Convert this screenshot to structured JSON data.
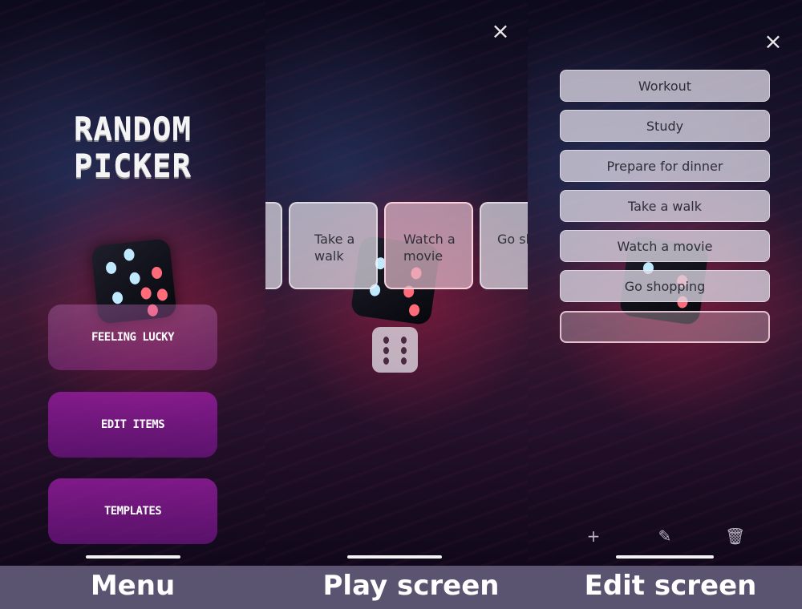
{
  "menu": {
    "title_line1": "RANDOM",
    "title_line2": "PICKER",
    "buttons": [
      "FEELING LUCKY",
      "EDIT ITEMS",
      "TEMPLATES"
    ]
  },
  "play": {
    "close_icon": "×",
    "cards": [
      "Take a walk",
      "Watch a movie",
      "Go shopp"
    ],
    "selected_card": "Watch a movie"
  },
  "edit": {
    "close_icon": "×",
    "items": [
      "Workout",
      "Study",
      "Prepare for dinner",
      "Take a walk",
      "Watch a movie",
      "Go shopping",
      ""
    ],
    "toolbar": {
      "add_icon": "+",
      "edit_icon": "✎",
      "delete_icon": "🗑"
    }
  },
  "captions": {
    "menu": "Menu",
    "play": "Play screen",
    "edit": "Edit screen"
  },
  "colors": {
    "caption_bar": "#5a5470",
    "menu_button": "#9a1ea8",
    "card": "#e1dce6"
  }
}
